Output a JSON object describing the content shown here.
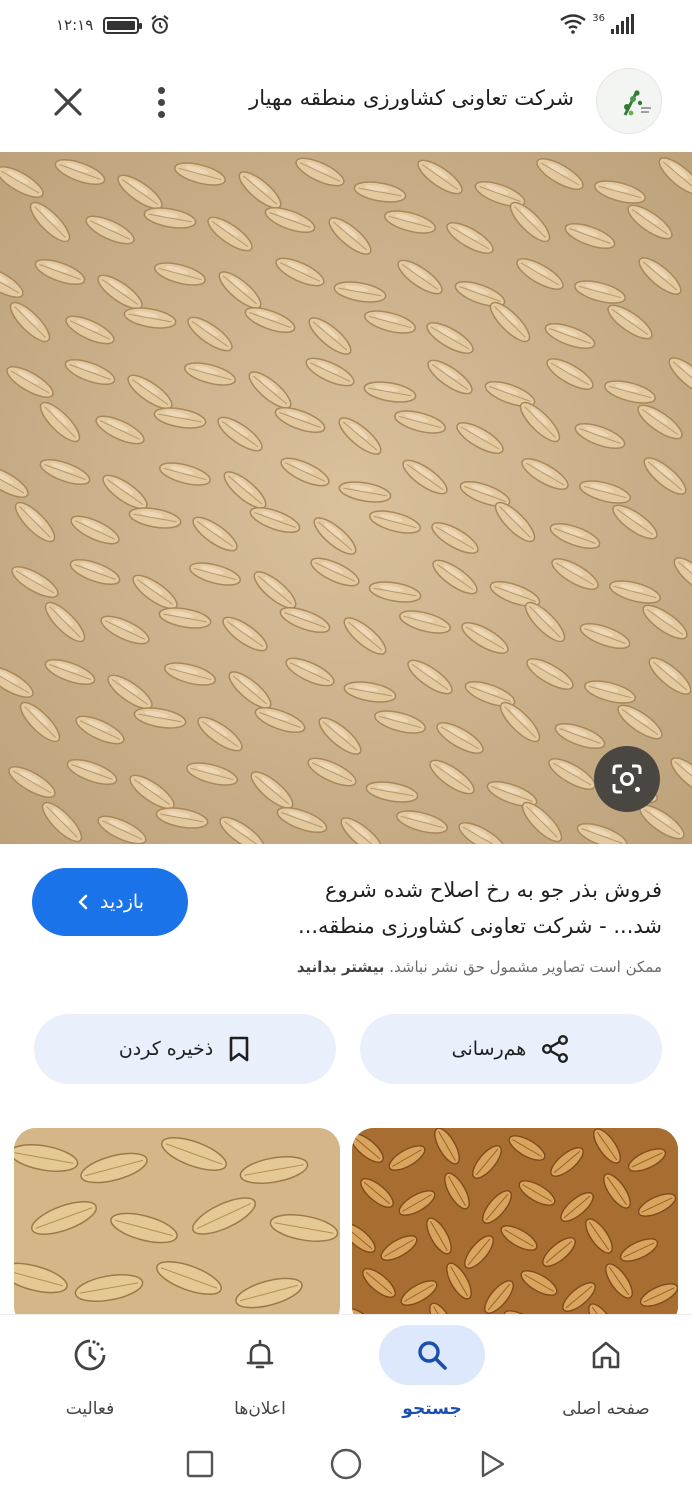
{
  "status_bar": {
    "time": "۱۲:۱۹",
    "network": "36",
    "icons": [
      "battery-icon",
      "alarm-icon",
      "wifi-icon",
      "signal-icon"
    ]
  },
  "header": {
    "site_title": "شرکت تعاونی کشاورزی منطقه مهیار",
    "icons": [
      "site-logo",
      "more-vert-icon",
      "close-icon"
    ]
  },
  "main_image": {
    "subject": "barley grains",
    "lens_icon": "google-lens-icon"
  },
  "result": {
    "title_line1": "فروش بذر جو به رخ اصلاح شده شروع",
    "title_line2": "شد... - شرکت تعاونی کشاورزی منطقه...",
    "visit_label": "بازدید",
    "copyright_text": "ممکن است تصاویر مشمول حق نشر نباشد.",
    "learn_more": "بیشتر بدانید"
  },
  "actions": {
    "share_label": "هم‌رسانی",
    "save_label": "ذخیره کردن"
  },
  "bottom_nav": {
    "home": "صفحه اصلی",
    "search": "جستجو",
    "notifications": "اعلان‌ها",
    "activity": "فعالیت",
    "active": "search"
  },
  "colors": {
    "accent": "#1a73e8",
    "action_bg": "#e9effb",
    "nav_active_bg": "#dde8fc"
  }
}
